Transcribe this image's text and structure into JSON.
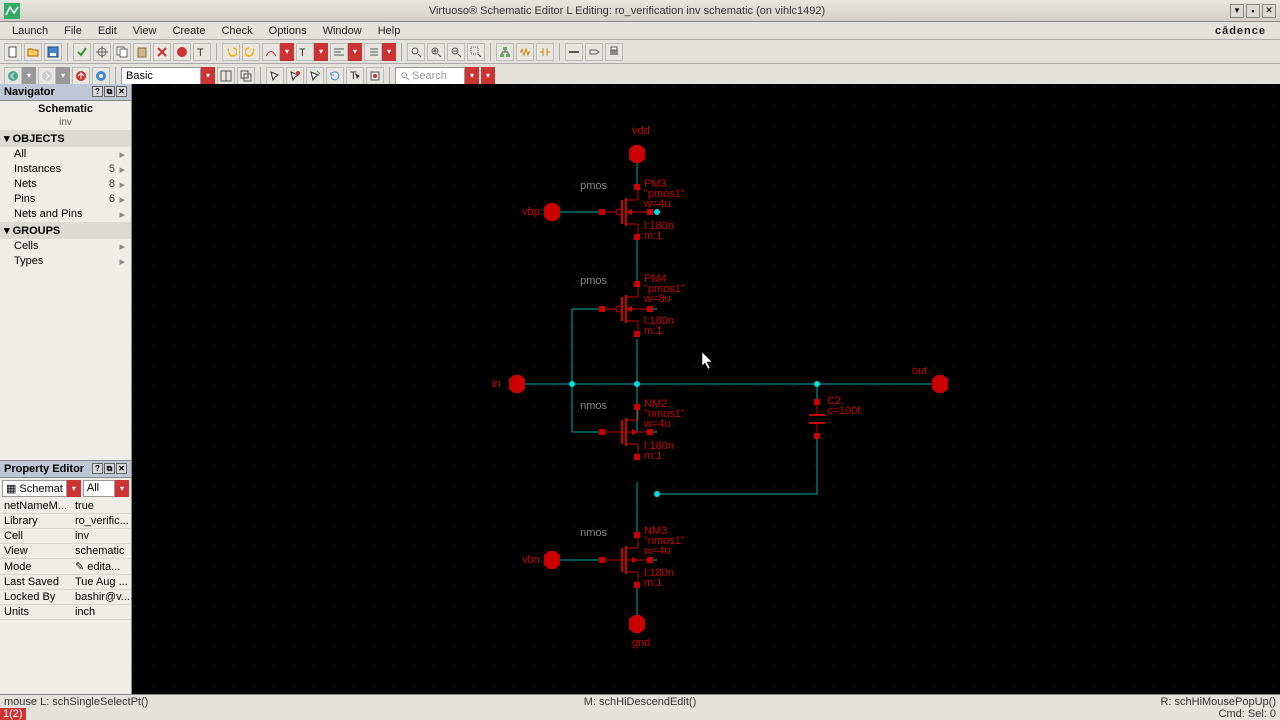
{
  "window": {
    "title": "Virtuoso® Schematic Editor L Editing: ro_verification inv schematic (on vihlc1492)",
    "brand": "cādence"
  },
  "menu": [
    "Launch",
    "File",
    "Edit",
    "View",
    "Create",
    "Check",
    "Options",
    "Window",
    "Help"
  ],
  "toolbar2": {
    "combo1": "Basic",
    "search_placeholder": "Search"
  },
  "navigator": {
    "title": "Navigator",
    "heading": "Schematic",
    "sub": "inv",
    "groups": {
      "objects_label": "OBJECTS",
      "objects": [
        {
          "label": "All",
          "count": "",
          "more": "▸"
        },
        {
          "label": "Instances",
          "count": "5",
          "more": "▸"
        },
        {
          "label": "Nets",
          "count": "8",
          "more": "▸"
        },
        {
          "label": "Pins",
          "count": "6",
          "more": "▸"
        },
        {
          "label": "Nets and Pins",
          "count": "",
          "more": "▸"
        }
      ],
      "groups_label": "GROUPS",
      "groups": [
        {
          "label": "Cells",
          "count": "",
          "more": "▸"
        },
        {
          "label": "Types",
          "count": "",
          "more": "▸"
        }
      ]
    },
    "add": "+"
  },
  "propEditor": {
    "title": "Property Editor",
    "combo1": "Schemat",
    "combo2": "All",
    "rows": [
      {
        "k": "netNameM...",
        "v": "true"
      },
      {
        "k": "Library",
        "v": "ro_verific..."
      },
      {
        "k": "Cell",
        "v": "inv"
      },
      {
        "k": "View",
        "v": "schematic"
      },
      {
        "k": "Mode",
        "v": "✎ edita..."
      },
      {
        "k": "Last Saved",
        "v": "Tue Aug ..."
      },
      {
        "k": "Locked By",
        "v": "bashir@v..."
      },
      {
        "k": "Units",
        "v": "inch"
      }
    ]
  },
  "schematic": {
    "pins": {
      "vdd": "vdd",
      "vbp": "vbp",
      "in": "in",
      "out": "out",
      "vbn": "vbn",
      "gnd": "gnd"
    },
    "devices": {
      "PM3": {
        "type": "pmos",
        "inst": "PM3",
        "model": "\"pmos1\"",
        "w": "w=4u",
        "l": "l:180n",
        "m": "m:1"
      },
      "PM4": {
        "type": "pmos",
        "inst": "PM4",
        "model": "\"pmos1\"",
        "w": "w=8u",
        "l": "l:180n",
        "m": "m:1"
      },
      "NM2": {
        "type": "nmos",
        "inst": "NM2",
        "model": "\"nmos1\"",
        "w": "w=4u",
        "l": "l:180n",
        "m": "m:1"
      },
      "NM3": {
        "type": "nmos",
        "inst": "NM3",
        "model": "\"nmos1\"",
        "w": "w=4u",
        "l": "l:180n",
        "m": "m:1"
      },
      "C2": {
        "inst": "C2",
        "val": "c=100f"
      }
    }
  },
  "status": {
    "left": "mouse L: schSingleSelectPt()",
    "mid": "M: schHiDescendEdit()",
    "right": "R: schHiMousePopUp()",
    "cmd_prompt": "1(2)",
    "cmd_right": "Cmd:    Sel: 0"
  }
}
